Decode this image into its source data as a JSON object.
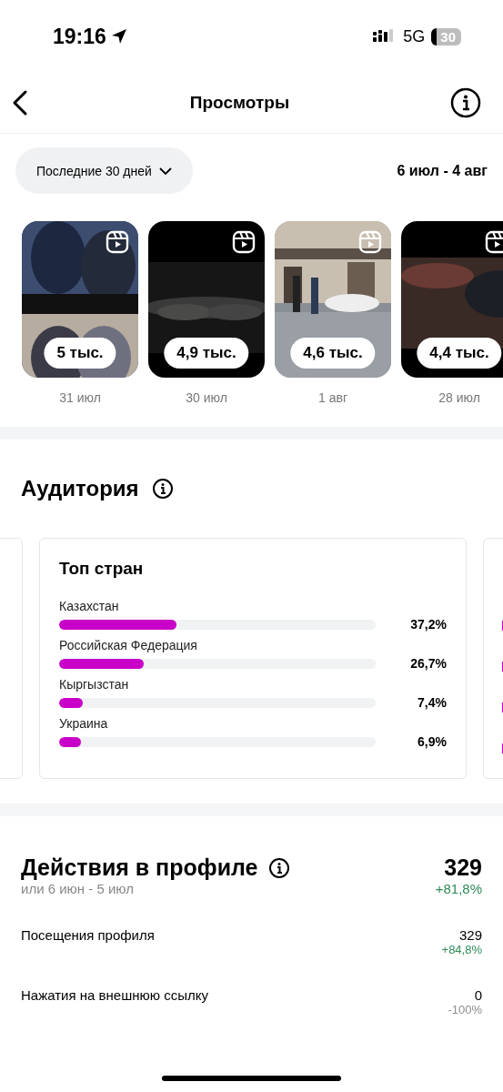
{
  "status_bar": {
    "time": "19:16",
    "network": "5G",
    "battery": "30"
  },
  "header": {
    "title": "Просмотры"
  },
  "filter": {
    "period": "Последние 30 дней",
    "range": "6 июл - 4 авг"
  },
  "reels": [
    {
      "views": "5 тыс.",
      "date": "31 июл"
    },
    {
      "views": "4,9 тыс.",
      "date": "30 июл"
    },
    {
      "views": "4,6 тыс.",
      "date": "1 авг"
    },
    {
      "views": "4,4 тыс.",
      "date": "28 июл"
    }
  ],
  "audience": {
    "title": "Аудитория",
    "card": {
      "title": "Топ стран",
      "rows": [
        {
          "name": "Казахстан",
          "level": 0.372,
          "value": "37,2%"
        },
        {
          "name": "Российская Федерация",
          "level": 0.267,
          "value": "26,7%"
        },
        {
          "name": "Кыргызстан",
          "level": 0.074,
          "value": "7,4%"
        },
        {
          "name": "Украина",
          "level": 0.069,
          "value": "6,9%"
        }
      ]
    }
  },
  "profile_actions": {
    "title": "Действия в профиле",
    "compare": "или 6 июн - 5 июл",
    "total": "329",
    "change": "+81,8%",
    "color": "#2e8b57",
    "rows": [
      {
        "label": "Посещения профиля",
        "value": "329",
        "change": "+84,8%",
        "color": "#2e8b57"
      },
      {
        "label": "Нажатия на внешнюю ссылку",
        "value": "0",
        "change": "-100%",
        "color": "#8e8e8e"
      }
    ]
  }
}
